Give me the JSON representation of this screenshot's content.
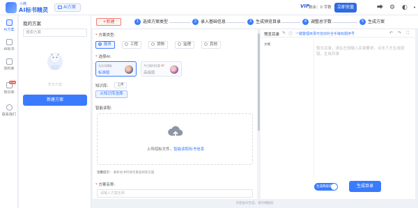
{
  "brand": {
    "small": "小微",
    "name": "AI标书精灵",
    "tag": "AI方案"
  },
  "account": {
    "vip": "VIP",
    "balance": "剩余：0 字数",
    "recharge": "立即充值"
  },
  "top_icons": [
    "share-icon",
    "settings-icon",
    "theme-icon",
    "fullscreen-icon",
    "help-icon"
  ],
  "nav": [
    {
      "label": "AI方案",
      "icon": "ai-plan-icon",
      "active": true
    },
    {
      "label": "AI标书",
      "icon": "ai-bid-icon"
    },
    {
      "label": "资料库",
      "icon": "library-icon"
    },
    {
      "label": "知识库",
      "icon": "knowledge-icon",
      "badge": "new"
    },
    {
      "label": "联系我们",
      "icon": "contact-icon"
    }
  ],
  "plans": {
    "title": "我的方案",
    "search_placeholder": "搜索方案",
    "empty_text": "暂无方案",
    "new_button": "新建方案"
  },
  "steps": {
    "new_button": "+新建",
    "items": [
      {
        "num": "1",
        "label": "选择方案类型"
      },
      {
        "num": "2",
        "label": "录入基础信息"
      },
      {
        "num": "3",
        "label": "生成预览目录"
      },
      {
        "num": "4",
        "label": "调整总字数"
      },
      {
        "num": "5",
        "label": "生成方案"
      }
    ]
  },
  "form": {
    "type_label": "方案类型:",
    "types": [
      "服务",
      "工程",
      "货物",
      "监理",
      "其他"
    ],
    "selected_type": "服务",
    "ai_label": "选择AI:",
    "ai_cards": [
      {
        "subtitle": "无水印模板",
        "name": "标准版",
        "selected": true
      },
      {
        "subtitle": "今日限时优惠",
        "price": "¥?",
        "name": "高级版",
        "selected": false
      }
    ],
    "kb_label": "知识库:",
    "kb_tag": "上传",
    "kb_button": "从知识库选择",
    "read_label": "智能读取:",
    "upload_text": "上传招标文件，",
    "upload_link": "智能读取标书信息",
    "tip_label": "温馨提示：",
    "tip_text": "解析标书时请勿重复刷新页面",
    "name_label": "方案名称:",
    "name_placeholder": "请输入方案名称"
  },
  "preview": {
    "title": "预览目录",
    "link": "一键整理目录可自动补全手输标题序号",
    "outline_item": "大纲",
    "placeholder": "暂无目录，请在左侧输入目录要求，点击下方生成按钮，生成目录",
    "toggle_label": "生成两级目录",
    "generate_button": "生成目录"
  },
  "footer": "内容由AI生成，请仔细甄别"
}
